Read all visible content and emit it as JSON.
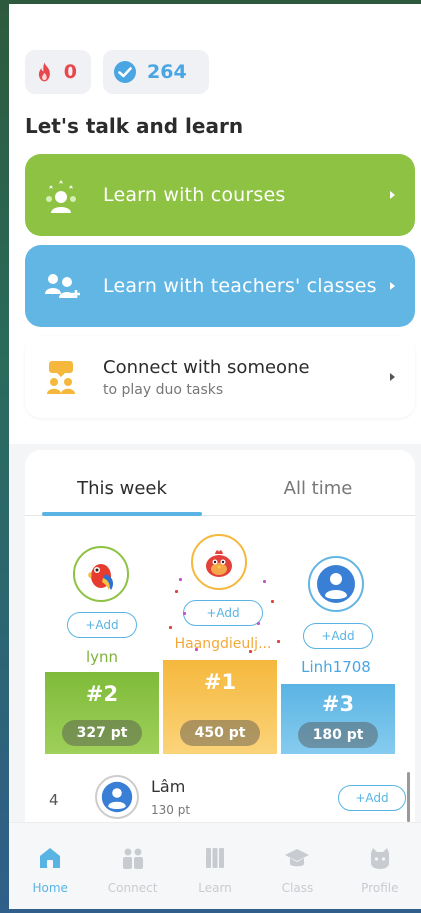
{
  "stats": {
    "streak_value": "0",
    "points_value": "264"
  },
  "section_heading": "Let's talk and learn",
  "cards": {
    "courses_label": "Learn with courses",
    "teachers_label": "Learn with teachers' classes",
    "connect_title": "Connect with someone",
    "connect_subtitle": "to play duo tasks"
  },
  "leaderboard": {
    "tabs": [
      "This week",
      "All time"
    ],
    "active_tab": "This week",
    "podium": [
      {
        "rank": "#2",
        "name": "lynn",
        "points": "327 pt",
        "add_label": "+Add",
        "color": "#8dc243"
      },
      {
        "rank": "#1",
        "name": "Haangdieulj...",
        "points": "450 pt",
        "add_label": "+Add",
        "color": "#f5b83d"
      },
      {
        "rank": "#3",
        "name": "Linh1708",
        "points": "180 pt",
        "add_label": "+Add",
        "color": "#62b6e4"
      }
    ],
    "list": [
      {
        "position": "4",
        "name": "Lâm",
        "points": "130 pt",
        "add_label": "+Add"
      }
    ]
  },
  "nav": {
    "items": [
      "Home",
      "Connect",
      "Learn",
      "Class",
      "Profile"
    ],
    "active": "Home"
  },
  "colors": {
    "accent_blue": "#5ab4e3",
    "green": "#8dc243",
    "gold": "#f5b83d",
    "streak_red": "#e8484b"
  },
  "icons": {
    "streak": "fire-icon",
    "points": "check-badge-icon",
    "courses": "group-star-icon",
    "teachers": "people-add-icon",
    "connect": "chat-people-icon"
  }
}
